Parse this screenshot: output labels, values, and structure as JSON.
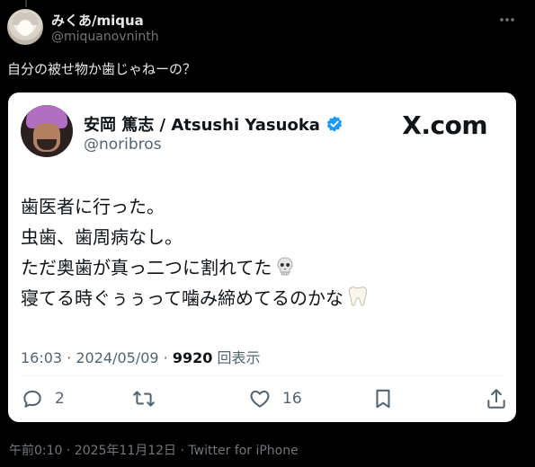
{
  "author": {
    "name": "みくあ/miqua",
    "handle": "@miquanovninth"
  },
  "tweet": {
    "text": "自分の被せ物か歯じゃねーの？"
  },
  "quote_card": {
    "name": "安岡 篤志 / Atsushi Yasuoka",
    "handle": "@noribros",
    "source_logo": "X.com",
    "lines": [
      "歯医者に行った。",
      "虫歯、歯周病なし。",
      "ただ奥歯が真っ二つに割れてた",
      "寝てる時ぐぅぅって噛み締めてるのかな"
    ],
    "line_emoji": [
      "",
      "",
      "skull-emoji",
      "tooth-emoji"
    ],
    "meta_prefix": "16:03 · 2024/05/09 · ",
    "views_count": "9920",
    "views_label": "回表示",
    "actions": {
      "reply_count": "2",
      "like_count": "16"
    },
    "icons": [
      "verified-badge-icon",
      "reply-icon",
      "retweet-icon",
      "like-icon",
      "bookmark-icon",
      "share-icon"
    ],
    "accent_color": "#1d9bf0"
  },
  "footer": {
    "meta": "午前0:10 · 2025年11月12日 · Twitter for iPhone"
  }
}
